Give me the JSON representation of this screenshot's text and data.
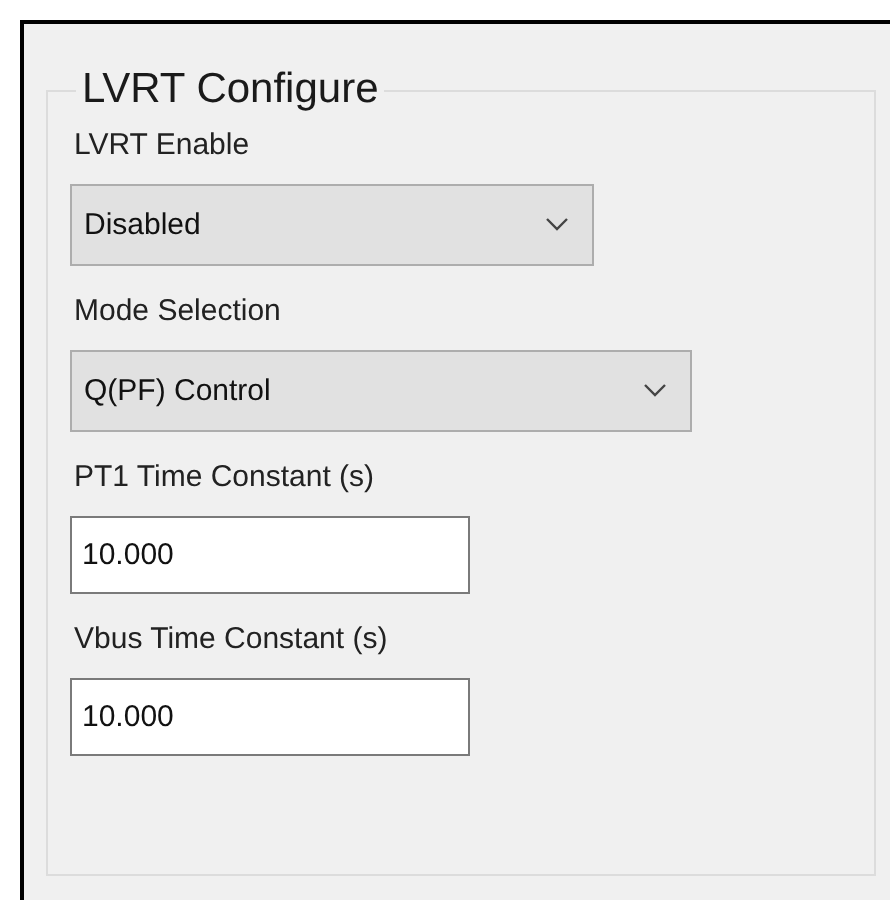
{
  "group": {
    "title": "LVRT Configure"
  },
  "fields": [
    {
      "kind": "dropdown",
      "label": "LVRT Enable",
      "value": "Disabled",
      "wide": false
    },
    {
      "kind": "dropdown",
      "label": "Mode Selection",
      "value": "Q(PF) Control",
      "wide": true
    },
    {
      "kind": "textbox",
      "label": "PT1 Time Constant (s)",
      "value": "10.000"
    },
    {
      "kind": "textbox",
      "label": "Vbus Time Constant (s)",
      "value": "10.000"
    }
  ]
}
